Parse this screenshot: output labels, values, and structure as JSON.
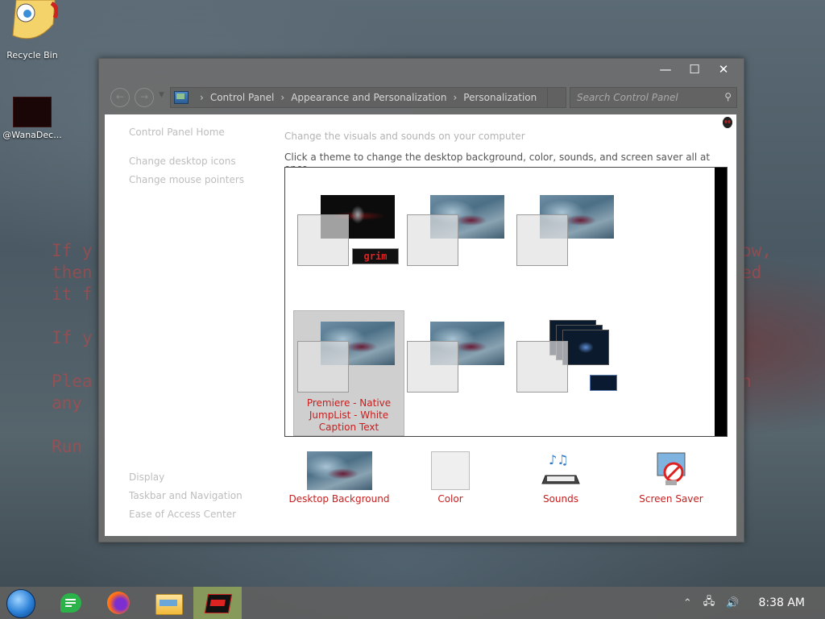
{
  "desktop": {
    "icons": [
      {
        "label": "Recycle Bin",
        "icon": "recycle-bin-icon"
      },
      {
        "label": "@WanaDec...",
        "icon": "app-icon"
      }
    ],
    "background_text_left": [
      "If y",
      "then",
      "it f",
      "",
      "If y",
      "",
      "Plea",
      "any",
      "",
      "Run"
    ],
    "background_text_right": [
      "ow,",
      "ed",
      "",
      "",
      "",
      "",
      "n"
    ]
  },
  "window": {
    "controls": {
      "minimize": "—",
      "maximize": "☐",
      "close": "✕"
    },
    "breadcrumb": [
      "Control Panel",
      "Appearance and Personalization",
      "Personalization"
    ],
    "search_placeholder": "Search Control Panel",
    "sidebar": {
      "home": "Control Panel Home",
      "links": [
        "Change desktop icons",
        "Change mouse pointers"
      ],
      "see_also": [
        "Display",
        "Taskbar and Navigation",
        "Ease of Access Center"
      ]
    },
    "heading": "Change the visuals and sounds on your computer",
    "subheading": "Click a theme to change the desktop background, color, sounds, and screen saver all at once.",
    "themes": [
      {
        "name": "",
        "style": "dark",
        "badge": "grim"
      },
      {
        "name": "",
        "style": "blue"
      },
      {
        "name": "",
        "style": "blue"
      },
      {
        "name": "Premiere - Native JumpList - White Caption Text",
        "style": "blue",
        "selected": true
      },
      {
        "name": "",
        "style": "blue"
      },
      {
        "name": "",
        "style": "stack"
      }
    ],
    "bottom": [
      {
        "label": "Desktop Background",
        "icon": "desktop-background-icon"
      },
      {
        "label": "Color",
        "icon": "color-swatch-icon"
      },
      {
        "label": "Sounds",
        "icon": "sounds-icon"
      },
      {
        "label": "Screen Saver",
        "icon": "screen-saver-icon"
      }
    ]
  },
  "taskbar": {
    "apps": [
      "start-orb-icon",
      "notes-icon",
      "firefox-icon",
      "file-explorer-icon",
      "personalization-icon"
    ],
    "clock": "8:38 AM",
    "tray_icons": [
      "chevron-up-icon",
      "network-icon",
      "volume-icon"
    ]
  },
  "colors": {
    "accent_red": "#c81e1e",
    "taskbar_active": "#96af5a"
  }
}
